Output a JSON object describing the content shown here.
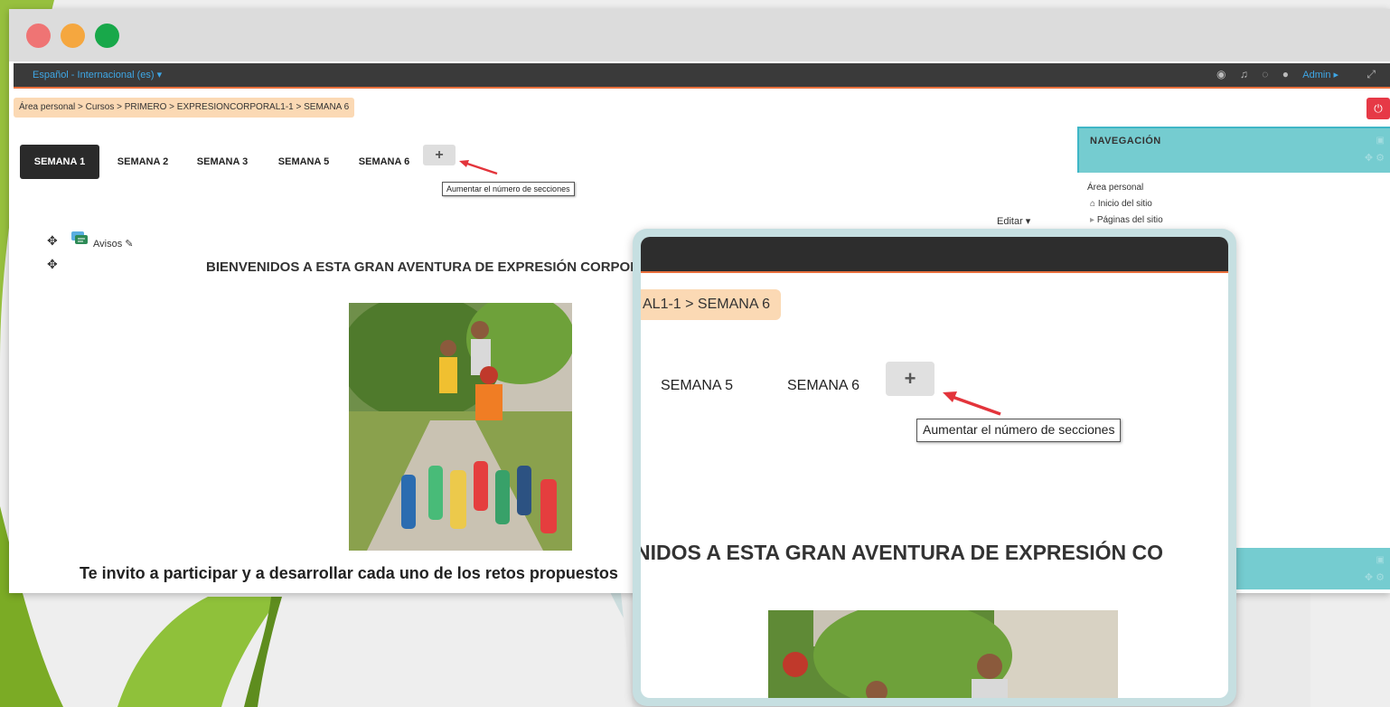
{
  "navbar": {
    "language": "Español - Internacional (es) ▾",
    "user": "Admin ▸"
  },
  "breadcrumb": "Área personal > Cursos > PRIMERO > EXPRESIONCORPORAL1-1 > SEMANA 6",
  "tabs": [
    {
      "label": "SEMANA 1",
      "active": true
    },
    {
      "label": "SEMANA 2",
      "active": false
    },
    {
      "label": "SEMANA 3",
      "active": false
    },
    {
      "label": "SEMANA 5",
      "active": false
    },
    {
      "label": "SEMANA 6",
      "active": false
    }
  ],
  "add_section": {
    "label": "+",
    "tooltip": "Aumentar el número de secciones"
  },
  "edit_menu": "Editar ▾",
  "activity": {
    "name": "Avisos"
  },
  "content": {
    "welcome": "BIENVENIDOS A ESTA GRAN AVENTURA DE EXPRESIÓN CORPORAL",
    "invite": "Te invito a participar y a desarrollar cada uno de los retos propuestos"
  },
  "navigation_block": {
    "title": "NAVEGACIÓN",
    "items": [
      "Área personal",
      "Inicio del sitio",
      "Páginas del sitio"
    ]
  },
  "zoom": {
    "breadcrumb_tail": "AL1-1 > SEMANA 6",
    "tabs": [
      "SEMANA 5",
      "SEMANA 6"
    ],
    "add_label": "+",
    "tooltip": "Aumentar el número de secciones",
    "welcome": "NIDOS A ESTA GRAN AVENTURA DE EXPRESIÓN CO"
  },
  "colors": {
    "accent_orange": "#e9703d",
    "nav_block": "#75ccd0",
    "breadcrumb_bg": "#fbd9b4",
    "logout": "#e63946",
    "active_tab": "#2a2a2a",
    "arrow": "#e3343b"
  }
}
